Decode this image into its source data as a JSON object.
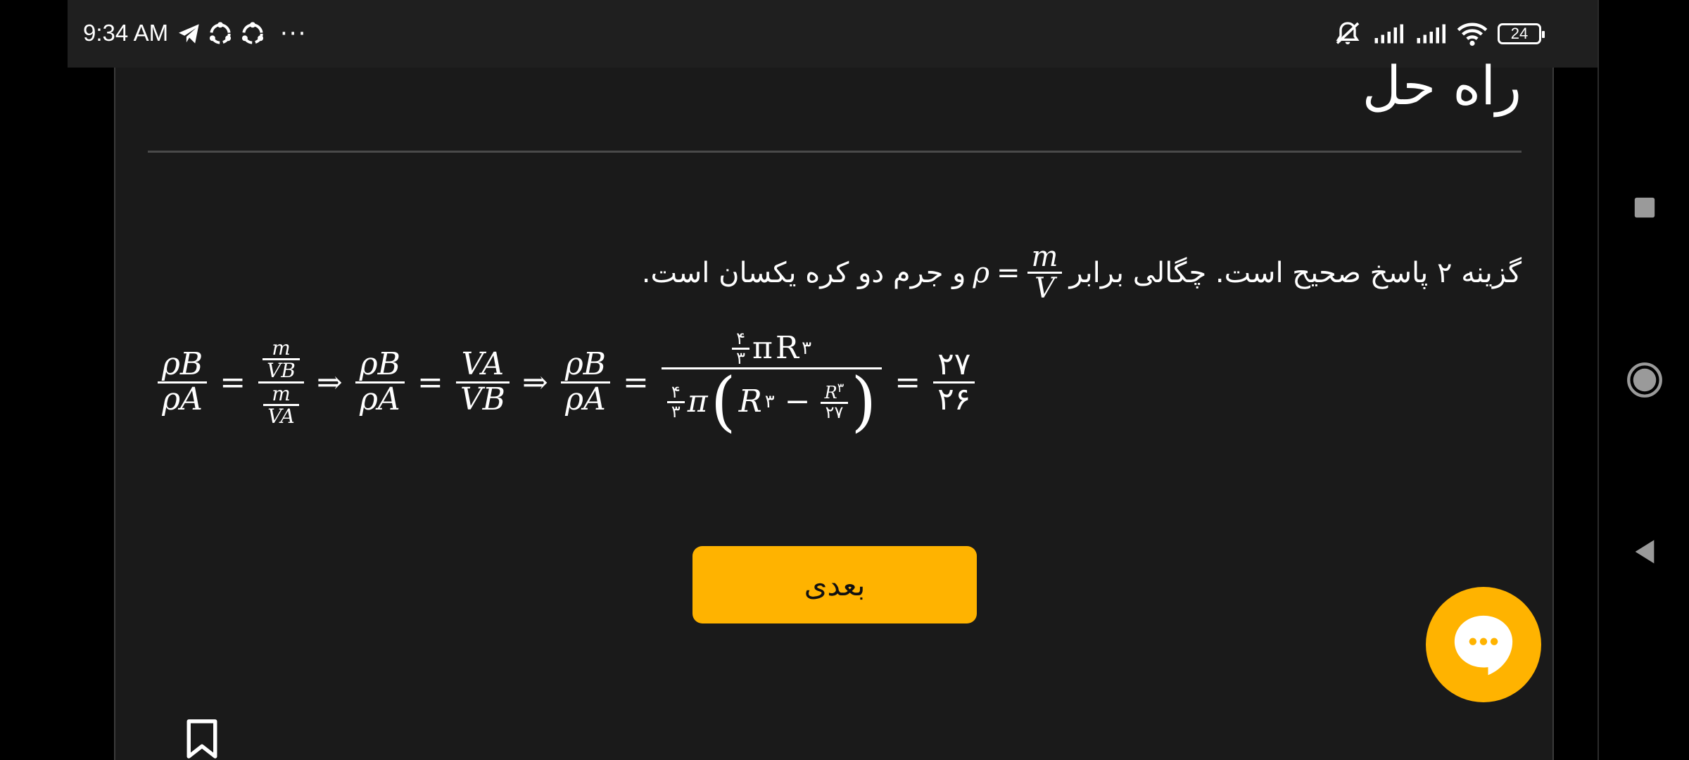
{
  "status_bar": {
    "time": "9:34 AM",
    "left_icons": [
      "telegram-icon",
      "sync-icon",
      "sync-icon"
    ],
    "more": "···",
    "right_icons": [
      "mute-icon",
      "signal-icon",
      "signal-icon",
      "wifi-icon"
    ],
    "battery": "24"
  },
  "page": {
    "heading": "راه حل",
    "solution_text_before": "گزینه ۲ پاسخ صحیح است. چگالی برابر",
    "solution_text_after": "و جرم دو کره یکسان است.",
    "density_symbol": "ρ",
    "density_eq": "=",
    "density_num": "m",
    "density_den": "V"
  },
  "equation": {
    "rhoB": "ρB",
    "rhoA": "ρA",
    "m": "m",
    "VB": "VB",
    "VA": "VA",
    "eq": "=",
    "implies": "⇒",
    "four": "۴",
    "three": "۳",
    "pi": "π",
    "R3": "R",
    "exp": "۳",
    "minus": "−",
    "twentyseven": "۲۷",
    "res_num": "۲۷",
    "res_den": "۲۶"
  },
  "next_button": {
    "label": "بعدی"
  },
  "colors": {
    "accent": "#ffb300",
    "card_bg": "#1a1a1a",
    "status_bg": "#1f1f1f"
  }
}
